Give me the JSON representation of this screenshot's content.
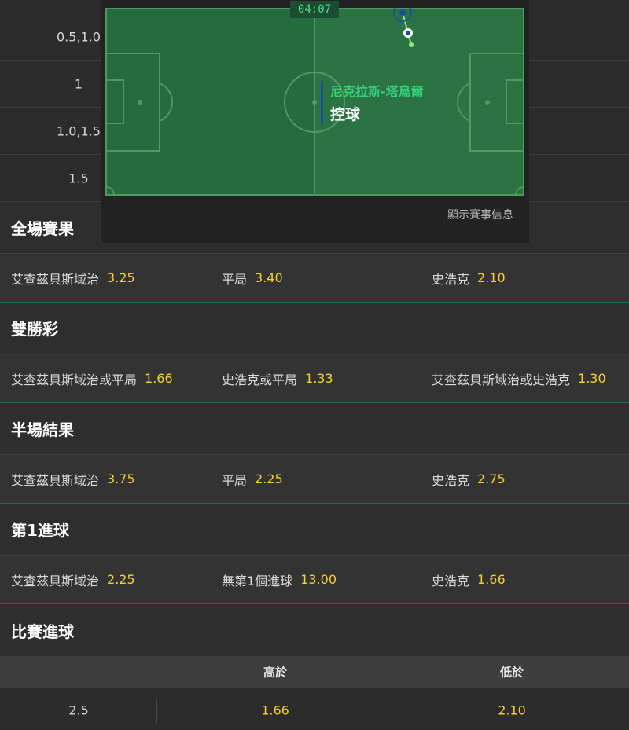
{
  "handicap_lines": [
    "0.5,1.0",
    "1",
    "1.0,1.5",
    "1.5"
  ],
  "visualiser": {
    "timer": "04:07",
    "team_in_possession": "尼克拉斯-塔烏爾",
    "state": "控球",
    "info_link": "顯示賽事信息",
    "colors": {
      "pitch_dark": "#266b3d",
      "pitch_light": "#2d7a45",
      "line": "#5fa771",
      "team": "#34d07c"
    }
  },
  "markets": [
    {
      "title": "全場賽果",
      "outcomes": [
        {
          "name": "艾查茲貝斯域治",
          "price": "3.25"
        },
        {
          "name": "平局",
          "price": "3.40"
        },
        {
          "name": "史浩克",
          "price": "2.10"
        }
      ]
    },
    {
      "title": "雙勝彩",
      "outcomes": [
        {
          "name": "艾查茲貝斯域治或平局",
          "price": "1.66"
        },
        {
          "name": "史浩克或平局",
          "price": "1.33"
        },
        {
          "name": "艾查茲貝斯域治或史浩克",
          "price": "1.30"
        }
      ]
    },
    {
      "title": "半場結果",
      "outcomes": [
        {
          "name": "艾查茲貝斯域治",
          "price": "3.75"
        },
        {
          "name": "平局",
          "price": "2.25"
        },
        {
          "name": "史浩克",
          "price": "2.75"
        }
      ]
    },
    {
      "title": "第1進球",
      "outcomes": [
        {
          "name": "艾查茲貝斯域治",
          "price": "2.25"
        },
        {
          "name": "無第1個進球",
          "price": "13.00"
        },
        {
          "name": "史浩克",
          "price": "1.66"
        }
      ]
    }
  ],
  "totals": {
    "title": "比賽進球",
    "over_label": "高於",
    "under_label": "低於",
    "rows": [
      {
        "line": "2.5",
        "over": "1.66",
        "under": "2.10"
      }
    ]
  },
  "colors": {
    "price": "#f5d327",
    "divider": "#1f6b4f",
    "bg": "#2c2c2c"
  }
}
